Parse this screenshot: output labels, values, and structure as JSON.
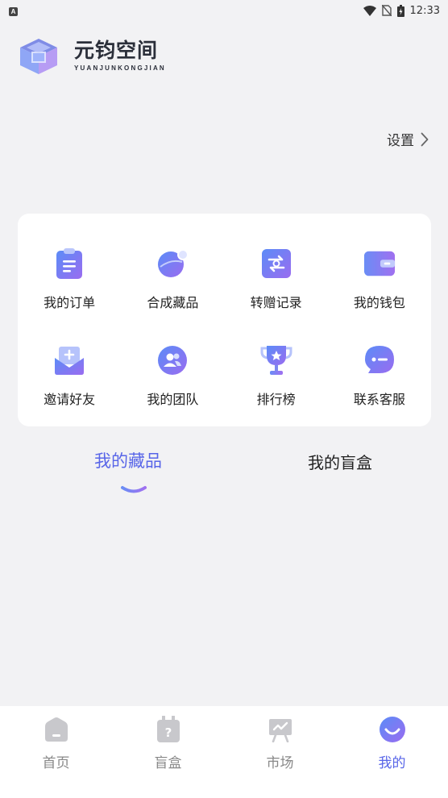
{
  "status_bar": {
    "left_badge": "A",
    "time": "12:33",
    "icons": [
      "wifi-icon",
      "no-sim-icon",
      "battery-icon"
    ]
  },
  "brand": {
    "name_cn": "元钧空间",
    "name_en": "YUANJUNKONGJIAN"
  },
  "settings": {
    "label": "设置",
    "icon": "chevron-right-icon"
  },
  "menu": {
    "items": [
      {
        "label": "我的订单",
        "icon": "order-clipboard-icon"
      },
      {
        "label": "合成藏品",
        "icon": "synthesize-planet-icon"
      },
      {
        "label": "转赠记录",
        "icon": "transfer-record-icon"
      },
      {
        "label": "我的钱包",
        "icon": "wallet-icon"
      },
      {
        "label": "邀请好友",
        "icon": "invite-envelope-icon"
      },
      {
        "label": "我的团队",
        "icon": "team-icon"
      },
      {
        "label": "排行榜",
        "icon": "trophy-icon"
      },
      {
        "label": "联系客服",
        "icon": "chat-bubble-icon"
      }
    ]
  },
  "tabs": {
    "items": [
      {
        "label": "我的藏品",
        "active": true
      },
      {
        "label": "我的盲盒",
        "active": false
      }
    ]
  },
  "bottom_nav": {
    "items": [
      {
        "label": "首页",
        "icon": "home-icon",
        "active": false
      },
      {
        "label": "盲盒",
        "icon": "blind-box-icon",
        "active": false
      },
      {
        "label": "市场",
        "icon": "market-icon",
        "active": false
      },
      {
        "label": "我的",
        "icon": "profile-smile-icon",
        "active": true
      }
    ]
  },
  "colors": {
    "accent": "#5865e8",
    "icon_gradient_start": "#5b8cf7",
    "icon_gradient_end": "#9a6cf0",
    "background": "#f2f2f4",
    "inactive_nav": "#c8c8cc"
  }
}
